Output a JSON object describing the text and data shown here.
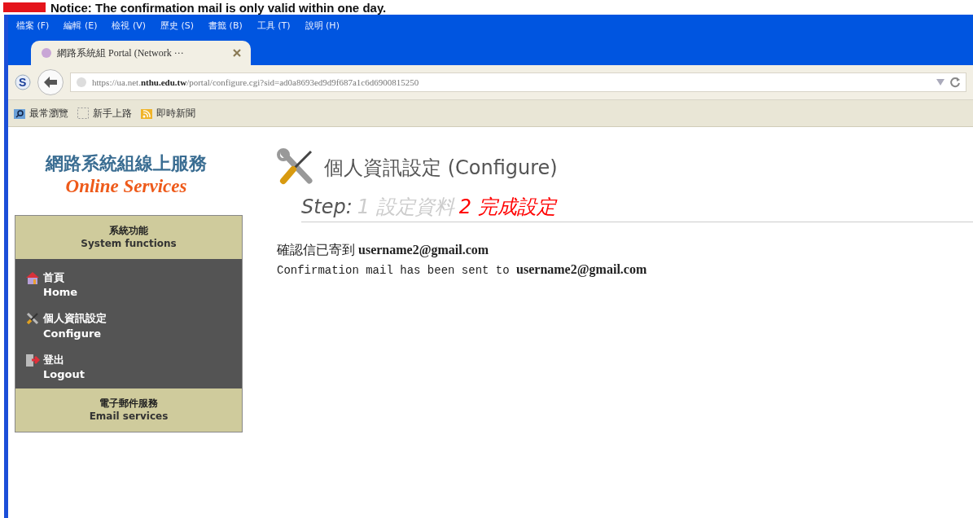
{
  "notice": {
    "text": "Notice: The confirmation mail is only valid within one day."
  },
  "menu_bar": [
    "檔案 (F)",
    "編輯 (E)",
    "檢視 (V)",
    "歷史 (S)",
    "書籤 (B)",
    "工具 (T)",
    "說明 (H)"
  ],
  "tabs": [
    {
      "title": "網路系統組 Portal (Network ···",
      "selected": true
    }
  ],
  "address_bar": {
    "logo": "S",
    "url": "https://ua.net.**nthu.edu.tw**/portal/configure.cgi?sid=ad0a8693ed9d9f687a1c6d6900815250"
  },
  "bookmarks": [
    {
      "kind": "search",
      "label": "最常瀏覽"
    },
    {
      "kind": "page",
      "label": "新手上路"
    },
    {
      "kind": "feed",
      "label": "即時新聞"
    }
  ],
  "sidebar": {
    "title": "網路系統組線上服務",
    "subtitle": "Online Services",
    "sections": [
      {
        "title": "系統功能",
        "title_en": "System functions",
        "items": [
          {
            "kind": "home",
            "label": "首頁",
            "label_en": "Home"
          },
          {
            "kind": "configure",
            "label": "個人資訊設定",
            "label_en": "Configure"
          },
          {
            "kind": "logout",
            "label": "登出",
            "label_en": "Logout"
          }
        ]
      },
      {
        "title": "電子郵件服務",
        "title_en": "Email services"
      }
    ]
  },
  "page": {
    "title": "個人資訊設定 (Configure)",
    "step_label": "Step:",
    "steps": [
      {
        "number": "1",
        "label": "設定資料",
        "selected": false
      },
      {
        "number": "2",
        "label": "完成設定",
        "selected": true
      }
    ],
    "messages": [
      {
        "kind": "zh",
        "text": "確認信已寄到 **username2@gmail.com**"
      },
      {
        "kind": "en",
        "text": "Confirmation mail has been sent to **username2@gmail.com**"
      }
    ]
  }
}
